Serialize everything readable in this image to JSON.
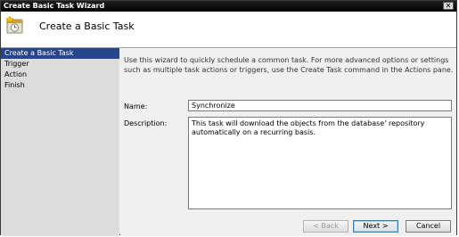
{
  "window": {
    "title": "Create Basic Task Wizard",
    "close_glyph": "✕"
  },
  "header": {
    "title": "Create a Basic Task",
    "icon": "task-scheduler-icon"
  },
  "nav": {
    "items": [
      {
        "label": "Create a Basic Task",
        "active": true
      },
      {
        "label": "Trigger",
        "active": false
      },
      {
        "label": "Action",
        "active": false
      },
      {
        "label": "Finish",
        "active": false
      }
    ]
  },
  "main": {
    "intro": "Use this wizard to quickly schedule a common task.  For more advanced options or settings such as multiple task actions or triggers, use the Create Task command in the Actions pane.",
    "name_label": "Name:",
    "name_value": "Synchronize",
    "description_label": "Description:",
    "description_value": "This task will download the objects from the database' repository automatically on a recurring basis."
  },
  "buttons": {
    "back": "< Back",
    "next": "Next >",
    "cancel": "Cancel"
  },
  "colors": {
    "accent": "#27458c",
    "titlebar": "#000000",
    "nav_bg": "#dcdcdc"
  }
}
